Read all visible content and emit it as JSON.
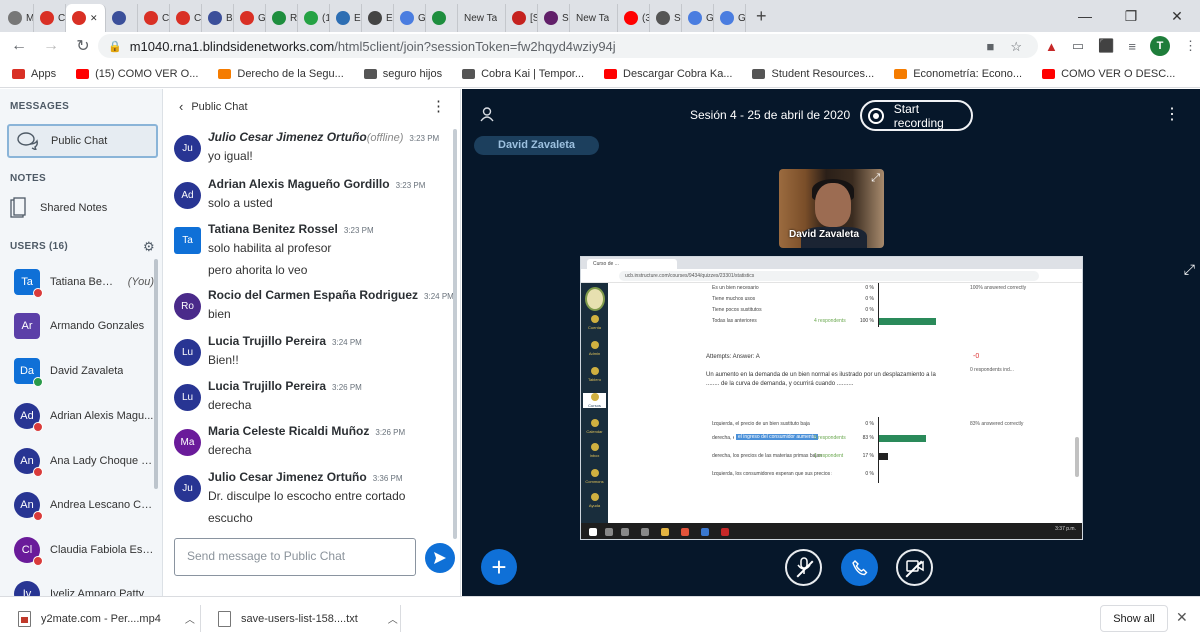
{
  "browser": {
    "tabs": [
      {
        "label": "M",
        "icon": "gmail-icon",
        "color": "#777777"
      },
      {
        "label": "Cc",
        "icon": "opera-icon",
        "color": "#d93025"
      },
      {
        "label": "",
        "icon": "blindside-icon",
        "color": "#d93025",
        "active": true
      },
      {
        "label": "",
        "icon": "blindside-icon",
        "color": "#3b4f9a"
      },
      {
        "label": "Cc",
        "icon": "opera-icon",
        "color": "#d93025"
      },
      {
        "label": "Cc",
        "icon": "opera-icon",
        "color": "#d93025"
      },
      {
        "label": "Bi",
        "icon": "blindside-icon",
        "color": "#3b4f9a"
      },
      {
        "label": "Gr",
        "icon": "opera-icon",
        "color": "#d93025"
      },
      {
        "label": "Re",
        "icon": "doc-icon",
        "color": "#1e8e3e"
      },
      {
        "label": "(1)",
        "icon": "whatsapp-icon",
        "color": "#25a244"
      },
      {
        "label": "Es",
        "icon": "trello-icon",
        "color": "#2d6eb3"
      },
      {
        "label": "Es",
        "icon": "at-icon",
        "color": "#444444"
      },
      {
        "label": "Gr",
        "icon": "translate-icon",
        "color": "#4a7de0"
      },
      {
        "label": "",
        "icon": "chat-icon",
        "color": "#1e8e3e"
      },
      {
        "label": "New Ta",
        "icon": "",
        "color": ""
      },
      {
        "label": "[S",
        "icon": "gmail-icon",
        "color": "#c5221f"
      },
      {
        "label": "Sl",
        "icon": "slack-icon",
        "color": "#611f69"
      },
      {
        "label": "New Ta",
        "icon": "",
        "color": ""
      },
      {
        "label": "(3",
        "icon": "youtube-icon",
        "color": "#ff0000"
      },
      {
        "label": "St",
        "icon": "gear-icon",
        "color": "#555555"
      },
      {
        "label": "Gr",
        "icon": "translate-icon",
        "color": "#4a7de0"
      },
      {
        "label": "Gr",
        "icon": "translate-icon",
        "color": "#4a7de0"
      }
    ],
    "url_host": "m1040.rna1.blindsidenetworks.com",
    "url_path": "/html5client/join?sessionToken=fw2hqyd4wziy94j",
    "profile_initial": "T",
    "bookmarks": [
      {
        "label": "Apps",
        "color": "#d93025"
      },
      {
        "label": "(15) COMO VER O...",
        "color": "#ff0000"
      },
      {
        "label": "Derecho de la Segu...",
        "color": "#f57c00"
      },
      {
        "label": "seguro hijos",
        "color": "#555555"
      },
      {
        "label": "Cobra Kai | Tempor...",
        "color": "#555555"
      },
      {
        "label": "Descargar Cobra Ka...",
        "color": "#ff0000"
      },
      {
        "label": "Student Resources...",
        "color": "#555555"
      },
      {
        "label": "Econometría: Econo...",
        "color": "#f57c00"
      },
      {
        "label": "COMO VER O DESC...",
        "color": "#ff0000"
      }
    ]
  },
  "sidebar": {
    "messages_title": "MESSAGES",
    "public_chat": "Public Chat",
    "notes_title": "NOTES",
    "shared_notes": "Shared Notes",
    "users_title": "USERS (16)",
    "users": [
      {
        "initials": "Ta",
        "name": "Tatiana Benite...",
        "you": "(You)",
        "color": "#0f70d7",
        "shape": "square",
        "mic": "red"
      },
      {
        "initials": "Ar",
        "name": "Armando Gonzales",
        "color": "#5b3fa8",
        "shape": "square",
        "mic": ""
      },
      {
        "initials": "Da",
        "name": "David Zavaleta",
        "color": "#0f70d7",
        "shape": "square",
        "mic": "green"
      },
      {
        "initials": "Ad",
        "name": "Adrian Alexis Magu...",
        "color": "#283593",
        "shape": "round",
        "mic": "red"
      },
      {
        "initials": "An",
        "name": "Ana Lady Choque C...",
        "color": "#283593",
        "shape": "round",
        "mic": "red"
      },
      {
        "initials": "An",
        "name": "Andrea Lescano Ch...",
        "color": "#283593",
        "shape": "round",
        "mic": "red"
      },
      {
        "initials": "Cl",
        "name": "Claudia Fabiola Esp...",
        "color": "#6a1b9a",
        "shape": "round",
        "mic": "red"
      },
      {
        "initials": "Iv",
        "name": "Iveliz Amparo Patty",
        "color": "#283593",
        "shape": "round",
        "mic": ""
      }
    ]
  },
  "chat": {
    "header": "Public Chat",
    "messages": [
      {
        "initials": "Ju",
        "color": "#283593",
        "shape": "round",
        "name": "Julio Cesar Jimenez Ortuño",
        "offline": "(offline)",
        "time": "3:23 PM",
        "lines": [
          "yo igual!"
        ],
        "italic": true
      },
      {
        "initials": "Ad",
        "color": "#283593",
        "shape": "round",
        "name": "Adrian Alexis Magueño Gordillo",
        "time": "3:23 PM",
        "lines": [
          "solo a usted"
        ]
      },
      {
        "initials": "Ta",
        "color": "#0f70d7",
        "shape": "square",
        "name": "Tatiana Benitez Rossel",
        "time": "3:23 PM",
        "lines": [
          "solo habilita al profesor",
          "pero ahorita lo veo"
        ]
      },
      {
        "initials": "Ro",
        "color": "#4a2a8a",
        "shape": "round",
        "name": "Rocio del Carmen España Rodriguez",
        "time": "3:24 PM",
        "lines": [
          "bien"
        ]
      },
      {
        "initials": "Lu",
        "color": "#283593",
        "shape": "round",
        "name": "Lucia Trujillo Pereira",
        "time": "3:24 PM",
        "lines": [
          "Bien!!"
        ]
      },
      {
        "initials": "Lu",
        "color": "#283593",
        "shape": "round",
        "name": "Lucia Trujillo Pereira",
        "time": "3:26 PM",
        "lines": [
          "derecha"
        ]
      },
      {
        "initials": "Ma",
        "color": "#6a1b9a",
        "shape": "round",
        "name": "Maria Celeste Ricaldi Muñoz",
        "time": "3:26 PM",
        "lines": [
          "derecha"
        ]
      },
      {
        "initials": "Ju",
        "color": "#283593",
        "shape": "round",
        "name": "Julio Cesar Jimenez Ortuño",
        "time": "3:36 PM",
        "lines": [
          "Dr. disculpe lo escocho entre cortado",
          "escucho"
        ]
      }
    ],
    "input_placeholder": "Send message to Public Chat"
  },
  "stage": {
    "session_title": "Sesión 4 - 25 de abril de 2020",
    "record_label": "Start recording",
    "talking": "David Zavaleta",
    "webcam_name": "David Zavaleta",
    "screen": {
      "tab_title": "Curso de ...",
      "url": "ucb.instructure.com/courses/9434/quizzes/23301/statistics",
      "nav": [
        {
          "label": "Cuenta"
        },
        {
          "label": "Admin"
        },
        {
          "label": "Tablero"
        },
        {
          "label": "Cursos",
          "active": true
        },
        {
          "label": "Calendar"
        },
        {
          "label": "Inbox"
        },
        {
          "label": "Commons"
        },
        {
          "label": "Ayuda"
        }
      ],
      "top_rows": [
        {
          "label": "Es un bien necesario",
          "pct": "0 %"
        },
        {
          "label": "Tiene muchos usos",
          "pct": "0 %"
        },
        {
          "label": "Tiene pocos sustitutos",
          "pct": "0 %"
        },
        {
          "label": "Todas las anteriores",
          "pct": "100 %",
          "tag": "4 respondents",
          "bar": 1.0
        }
      ],
      "top_note": "100% answered correctly",
      "question_label": "Attempts: Answer: A",
      "question_text": "Un aumento en la demanda de un bien normal es ilustrado por un desplazamiento a la ........ de la curva de demanda, y ocurrirá cuando ..........",
      "red_value": "-0",
      "red_note": "0 respondents ind...",
      "answer_rows": [
        {
          "label": "Izquierda, el precio de un bien sustituto baja",
          "pct": "0 %"
        },
        {
          "label": "derecha, el ingreso del consumidor aumenta",
          "pct": "83 %",
          "tag": "5 respondents",
          "bar": 0.83,
          "highlight": "el ingreso del consumidor aumenta"
        },
        {
          "label": "derecha, los precios de las materias primas bajan",
          "pct": "17 %",
          "tag": "1 respondent",
          "bar": 0.17,
          "dark": true
        },
        {
          "label": "Izquierda, los consumidores esperan que sus precios se reduzcan a costos más altos",
          "pct": "0 %"
        }
      ],
      "answer_note": "83% answered correctly",
      "clock": "3:37 p.m."
    }
  },
  "downloads": {
    "items": [
      {
        "name": "y2mate.com - Per....mp4",
        "icon": "video-file-icon"
      },
      {
        "name": "save-users-list-158....txt",
        "icon": "text-file-icon"
      }
    ],
    "show_all": "Show all"
  }
}
